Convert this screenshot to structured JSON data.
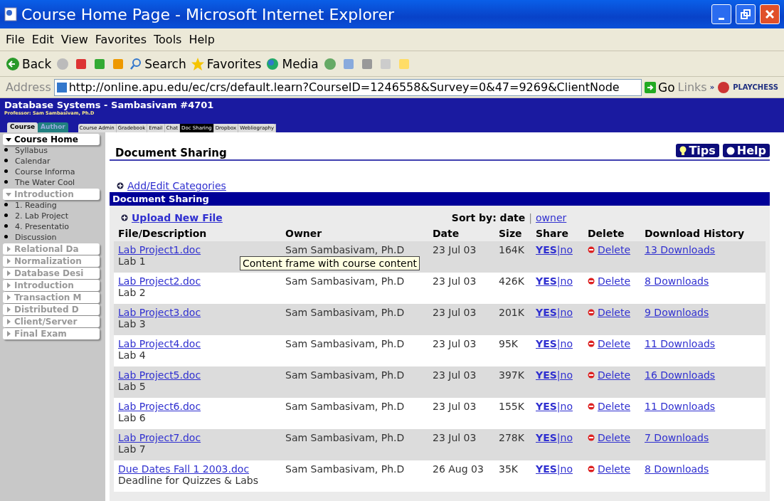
{
  "window": {
    "title": "Course Home Page - Microsoft Internet Explorer"
  },
  "menu": [
    "File",
    "Edit",
    "View",
    "Favorites",
    "Tools",
    "Help"
  ],
  "toolbar": {
    "back": "Back",
    "search": "Search",
    "favorites": "Favorites",
    "media": "Media"
  },
  "address_bar": {
    "label": "Address",
    "url": "http://online.apu.edu/ec/crs/default.learn?CourseID=1246558&Survey=0&47=9269&ClientNode",
    "go": "Go",
    "links": "Links",
    "more": "»",
    "link": "PLAYCHESS"
  },
  "course": {
    "title": "Database Systems - Sambasivam #4701",
    "professor": "Professor: Sam Sambasivam, Ph.D"
  },
  "mode_tabs": [
    {
      "label": "Course",
      "selected": true
    },
    {
      "label": "Author",
      "selected": false
    }
  ],
  "tool_tabs": [
    {
      "label": "Course Admin",
      "selected": false
    },
    {
      "label": "Gradebook",
      "selected": false
    },
    {
      "label": "Email",
      "selected": false
    },
    {
      "label": "Chat",
      "selected": false
    },
    {
      "label": "Doc Sharing",
      "selected": true
    },
    {
      "label": "Dropbox",
      "selected": false
    },
    {
      "label": "Webliography",
      "selected": false
    }
  ],
  "sidebar": {
    "items": [
      {
        "label": "Course Home",
        "expanded": true,
        "children": [
          {
            "label": "Syllabus"
          },
          {
            "label": "Calendar"
          },
          {
            "label": "Course Informa"
          },
          {
            "label": "The Water Cool"
          }
        ]
      },
      {
        "label": "Introduction",
        "expanded": true,
        "children": [
          {
            "label": "1. Reading"
          },
          {
            "label": "2. Lab Project"
          },
          {
            "label": "4. Presentatio"
          },
          {
            "label": "Discussion"
          }
        ]
      },
      {
        "label": "Relational Da",
        "expanded": false
      },
      {
        "label": "Normalization",
        "expanded": false
      },
      {
        "label": "Database Desi",
        "expanded": false
      },
      {
        "label": "Introduction",
        "expanded": false
      },
      {
        "label": "Transaction M",
        "expanded": false
      },
      {
        "label": "Distributed D",
        "expanded": false
      },
      {
        "label": "Client/Server",
        "expanded": false
      },
      {
        "label": "Final Exam",
        "expanded": false
      }
    ]
  },
  "page": {
    "heading": "Document Sharing",
    "tips": "Tips",
    "help": "Help",
    "add_categories": "Add/Edit Categories",
    "panel_title": "Document Sharing",
    "upload": "Upload New File",
    "sort_label": "Sort by: date",
    "sort_sep": "|",
    "sort_link": "owner"
  },
  "table": {
    "columns": [
      "File/Description",
      "Owner",
      "Date",
      "Size",
      "Share",
      "Delete",
      "Download History"
    ],
    "rows": [
      {
        "file": "Lab Project1.doc",
        "description": "Lab 1",
        "owner": "Sam Sambasivam, Ph.D",
        "date": "23 Jul 03",
        "size": "164K",
        "yes": "YES",
        "no": "|no",
        "delete": "Delete",
        "downloads": "13 Downloads"
      },
      {
        "file": "Lab Project2.doc",
        "description": "Lab 2",
        "owner": "Sam Sambasivam, Ph.D",
        "date": "23 Jul 03",
        "size": "426K",
        "yes": "YES",
        "no": "|no",
        "delete": "Delete",
        "downloads": "8 Downloads"
      },
      {
        "file": "Lab Project3.doc",
        "description": "Lab 3",
        "owner": "Sam Sambasivam, Ph.D",
        "date": "23 Jul 03",
        "size": "201K",
        "yes": "YES",
        "no": "|no",
        "delete": "Delete",
        "downloads": "9 Downloads"
      },
      {
        "file": "Lab Project4.doc",
        "description": "Lab 4",
        "owner": "Sam Sambasivam, Ph.D",
        "date": "23 Jul 03",
        "size": "95K",
        "yes": "YES",
        "no": "|no",
        "delete": "Delete",
        "downloads": "11 Downloads"
      },
      {
        "file": "Lab Project5.doc",
        "description": "Lab 5",
        "owner": "Sam Sambasivam, Ph.D",
        "date": "23 Jul 03",
        "size": "397K",
        "yes": "YES",
        "no": "|no",
        "delete": "Delete",
        "downloads": "16 Downloads"
      },
      {
        "file": "Lab Project6.doc",
        "description": "Lab 6",
        "owner": "Sam Sambasivam, Ph.D",
        "date": "23 Jul 03",
        "size": "155K",
        "yes": "YES",
        "no": "|no",
        "delete": "Delete",
        "downloads": "11 Downloads"
      },
      {
        "file": "Lab Project7.doc",
        "description": "Lab 7",
        "owner": "Sam Sambasivam, Ph.D",
        "date": "23 Jul 03",
        "size": "278K",
        "yes": "YES",
        "no": "|no",
        "delete": "Delete",
        "downloads": "7 Downloads"
      },
      {
        "file": "Due Dates Fall 1 2003.doc",
        "description": "Deadline for Quizzes & Labs",
        "owner": "Sam Sambasivam, Ph.D",
        "date": "26 Aug 03",
        "size": "35K",
        "yes": "YES",
        "no": "|no",
        "delete": "Delete",
        "downloads": "8 Downloads"
      }
    ]
  },
  "tooltip": {
    "text": "Content frame with course content"
  }
}
